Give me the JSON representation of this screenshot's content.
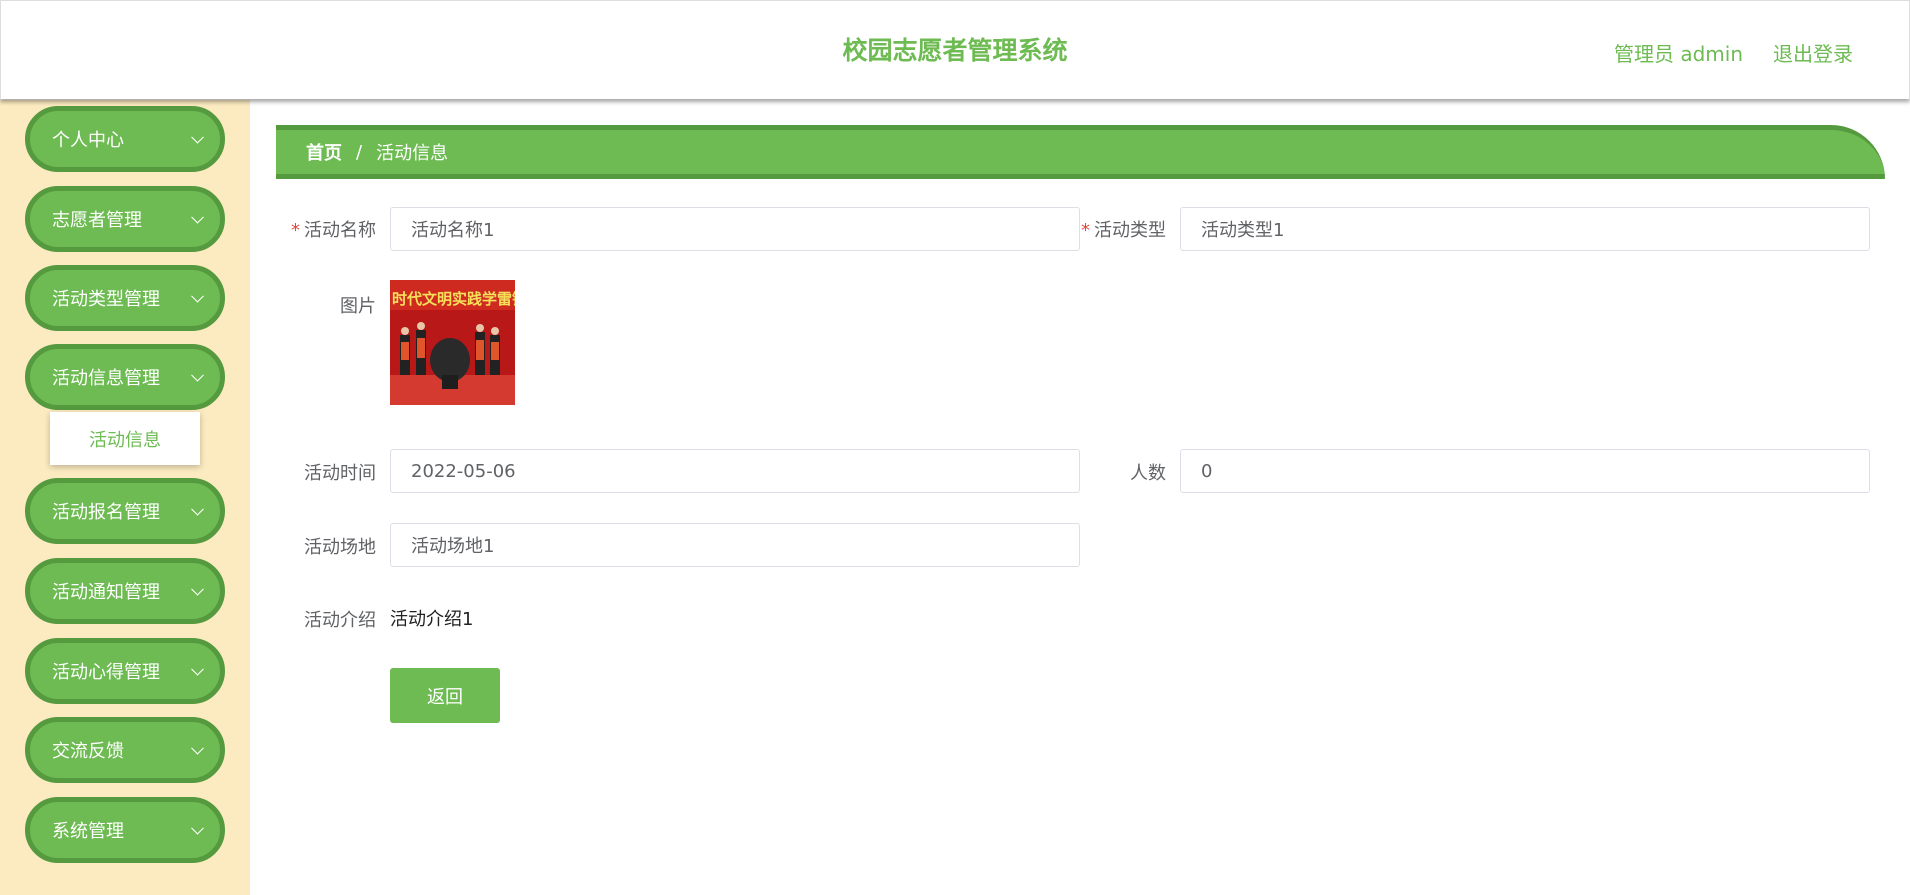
{
  "header": {
    "title": "校园志愿者管理系统",
    "user": "管理员 admin",
    "logout": "退出登录"
  },
  "sidebar": {
    "items": [
      {
        "label": "个人中心"
      },
      {
        "label": "志愿者管理"
      },
      {
        "label": "活动类型管理"
      },
      {
        "label": "活动信息管理"
      },
      {
        "label": "活动报名管理"
      },
      {
        "label": "活动通知管理"
      },
      {
        "label": "活动心得管理"
      },
      {
        "label": "交流反馈"
      },
      {
        "label": "系统管理"
      }
    ],
    "submenu": {
      "label": "活动信息"
    }
  },
  "breadcrumb": {
    "home": "首页",
    "separator": "/",
    "current": "活动信息"
  },
  "form": {
    "required_mark": "*",
    "name": {
      "label": "活动名称",
      "value": "活动名称1"
    },
    "type": {
      "label": "活动类型",
      "value": "活动类型1"
    },
    "image": {
      "label": "图片",
      "banner_text": "时代文明实践学雷锋"
    },
    "time": {
      "label": "活动时间",
      "value": "2022-05-06"
    },
    "count": {
      "label": "人数",
      "value": "0"
    },
    "venue": {
      "label": "活动场地",
      "value": "活动场地1"
    },
    "intro": {
      "label": "活动介绍",
      "value": "活动介绍1"
    },
    "back_button": "返回"
  },
  "colors": {
    "primary": "#6dbb52",
    "primary_dark": "#559a3f",
    "sidebar_bg": "#fcebc0",
    "required": "#e0463c"
  }
}
